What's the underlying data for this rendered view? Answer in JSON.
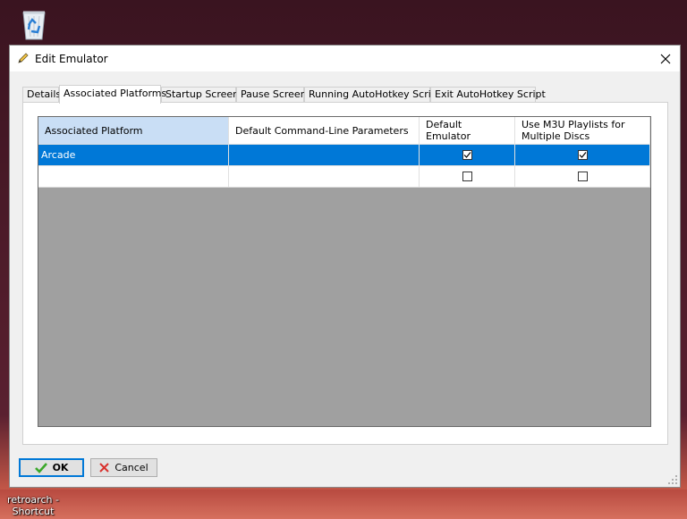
{
  "desktop": {
    "icon_label_line1": "retroarch -",
    "icon_label_line2": "Shortcut",
    "recycle_bin_icon": "recycle-bin-icon"
  },
  "dialog": {
    "title": "Edit Emulator",
    "title_icon": "pencil-icon",
    "close_icon": "close-icon"
  },
  "tabs": [
    {
      "label": "Details",
      "active": false
    },
    {
      "label": "Associated Platforms",
      "active": true
    },
    {
      "label": "Startup Screen",
      "active": false
    },
    {
      "label": "Pause Screen",
      "active": false
    },
    {
      "label": "Running AutoHotkey Script",
      "active": false
    },
    {
      "label": "Exit AutoHotkey Script",
      "active": false
    }
  ],
  "grid": {
    "columns": [
      "Associated Platform",
      "Default Command-Line Parameters",
      "Default Emulator",
      "Use M3U Playlists for Multiple Discs"
    ],
    "rows": [
      {
        "platform": "Arcade",
        "params": "",
        "default_emulator": true,
        "use_m3u": true,
        "selected": true
      },
      {
        "platform": "",
        "params": "",
        "default_emulator": false,
        "use_m3u": false,
        "selected": false
      }
    ]
  },
  "buttons": {
    "ok_label": "OK",
    "ok_icon": "checkmark-icon",
    "cancel_label": "Cancel",
    "cancel_icon": "x-icon"
  },
  "colors": {
    "selection": "#0078d7",
    "header_selected": "#c9def5",
    "grid_background": "#a0a0a0",
    "ok_check": "#3aa82a",
    "cancel_x": "#d9302c"
  }
}
